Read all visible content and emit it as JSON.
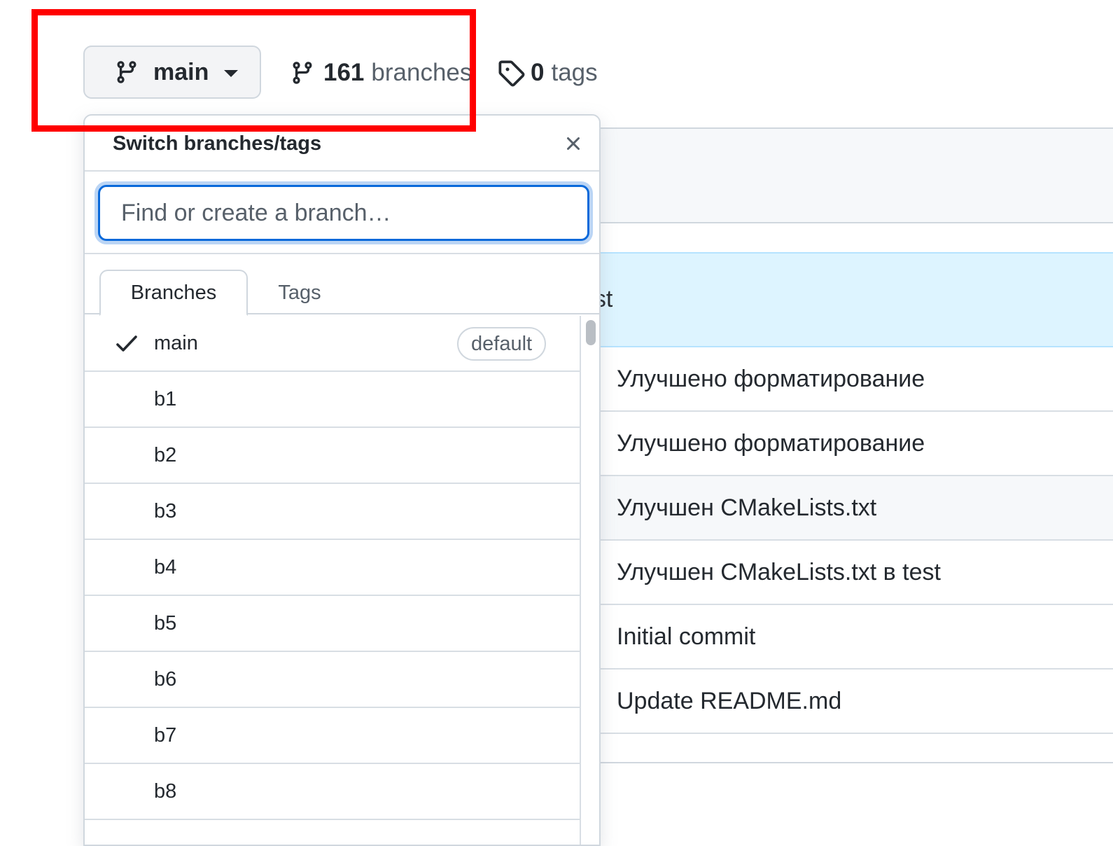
{
  "toolbar": {
    "branch_button_label": "main",
    "branches_count": "161",
    "branches_label": "branches",
    "tags_count": "0",
    "tags_label": "tags"
  },
  "dropdown": {
    "title": "Switch branches/tags",
    "search_placeholder": "Find or create a branch…",
    "tabs": [
      {
        "label": "Branches",
        "active": true
      },
      {
        "label": "Tags",
        "active": false
      }
    ],
    "items": [
      {
        "label": "main",
        "selected": true,
        "badge": "default"
      },
      {
        "label": "b1"
      },
      {
        "label": "b2"
      },
      {
        "label": "b3"
      },
      {
        "label": "b4"
      },
      {
        "label": "b5"
      },
      {
        "label": "b6"
      },
      {
        "label": "b7"
      },
      {
        "label": "b8"
      }
    ]
  },
  "background": {
    "highlight_partial_text": "est",
    "commits": [
      "Улучшено форматирование",
      "Улучшено форматирование",
      "Улучшен CMakeLists.txt",
      "Улучшен CMakeLists.txt в test",
      "Initial commit",
      "Update README.md"
    ]
  },
  "icons": {
    "branch": "git-branch-icon",
    "tag": "tag-icon",
    "close": "close-icon",
    "check": "check-icon",
    "caret": "caret-down-icon"
  },
  "colors": {
    "accent": "#0969da",
    "highlight_annotation": "#ff0000",
    "text_primary": "#24292f",
    "text_muted": "#57606a",
    "border": "#d0d7de"
  }
}
